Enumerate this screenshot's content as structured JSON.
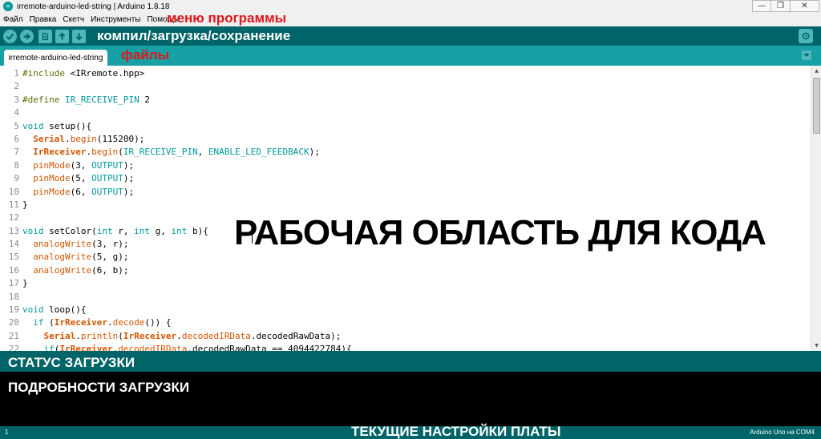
{
  "window": {
    "title": "irremote-arduino-led-string | Arduino 1.8.18",
    "minimize": "—",
    "maximize": "❐",
    "close": "✕"
  },
  "menu": {
    "items": [
      "Файл",
      "Правка",
      "Скетч",
      "Инструменты",
      "Помощь"
    ]
  },
  "toolbar": {
    "verify_icon": "check-icon",
    "upload_icon": "arrow-right-icon",
    "new_icon": "new-file-icon",
    "open_icon": "arrow-up-icon",
    "save_icon": "arrow-down-icon",
    "serial_icon": "magnifier-icon"
  },
  "tabs": {
    "active": "irremote-arduino-led-string"
  },
  "annotations": {
    "menu": "меню программы",
    "toolbar": "компил/загрузка/сохранение",
    "files": "файлы",
    "workspace": "РАБОЧАЯ ОБЛАСТЬ ДЛЯ КОДА",
    "status": "СТАТУС ЗАГРУЗКИ",
    "details": "ПОДРОБНОСТИ ЗАГРУЗКИ",
    "board": "ТЕКУЩИЕ НАСТРОЙКИ ПЛАТЫ"
  },
  "editor": {
    "line_numbers": [
      "1",
      "2",
      "3",
      "4",
      "5",
      "6",
      "7",
      "8",
      "9",
      "10",
      "11",
      "12",
      "13",
      "14",
      "15",
      "16",
      "17",
      "18",
      "19",
      "20",
      "21",
      "22"
    ],
    "lines": [
      "#include <IRremote.hpp>",
      "",
      "#define IR_RECEIVE_PIN 2",
      "",
      "void setup(){",
      "  Serial.begin(115200);",
      "  IrReceiver.begin(IR_RECEIVE_PIN, ENABLE_LED_FEEDBACK);",
      "  pinMode(3, OUTPUT);",
      "  pinMode(5, OUTPUT);",
      "  pinMode(6, OUTPUT);",
      "}",
      "",
      "void setColor(int r, int g, int b){",
      "  analogWrite(3, r);",
      "  analogWrite(5, g);",
      "  analogWrite(6, b);",
      "}",
      "",
      "void loop(){",
      "  if (IrReceiver.decode()) {",
      "    Serial.println(IrReceiver.decodedIRData.decodedRawData);",
      "    if(IrReceiver.decodedIRData.decodedRawData == 4094422784){"
    ]
  },
  "footer": {
    "line": "1",
    "board": "Arduino Uno на COM4"
  },
  "colors": {
    "toolbar_bg": "#006468",
    "tab_bar_bg": "#17a1a5",
    "button_bg": "#4db7bb",
    "annotation_red": "#e0161b"
  }
}
